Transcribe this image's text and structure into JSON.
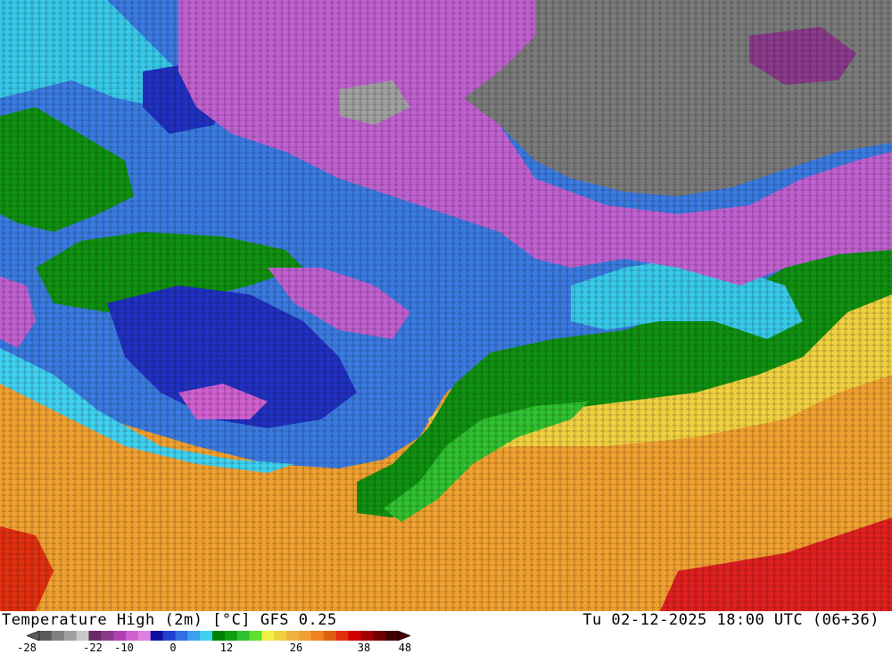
{
  "map": {
    "title": "Temperature High (2m) [°C] GFS 0.25",
    "valid_time": "Tu 02-12-2025 18:00 UTC (06+36)"
  },
  "legend": {
    "labels": [
      "-28",
      "-22",
      "-10",
      "0",
      "12",
      "26",
      "38",
      "48"
    ],
    "colors": [
      "#5a5a5a",
      "#808080",
      "#a0a0a0",
      "#c8c8c8",
      "#6a2a6a",
      "#8a3a8a",
      "#b040b0",
      "#d060d0",
      "#e080e0",
      "#1010a0",
      "#2040d0",
      "#3070e0",
      "#40a0f0",
      "#40d0f0",
      "#008000",
      "#10a010",
      "#30c030",
      "#60e030",
      "#f0f040",
      "#f0d040",
      "#f0b040",
      "#f0a030",
      "#f08020",
      "#e06010",
      "#e03010",
      "#d00000",
      "#a00000",
      "#700000",
      "#400000"
    ],
    "scale_arrow": "outlined triangle at each end"
  },
  "region_colors": {
    "grey": "#7a7a7a",
    "purple": "#c060d0",
    "dark_blue": "#2030c0",
    "blue": "#3a7ae0",
    "cyan": "#38c8e8",
    "green": "#109010",
    "bright_green": "#30c030",
    "yellow": "#f0d040",
    "orange": "#f0a030",
    "red": "#e02020"
  }
}
